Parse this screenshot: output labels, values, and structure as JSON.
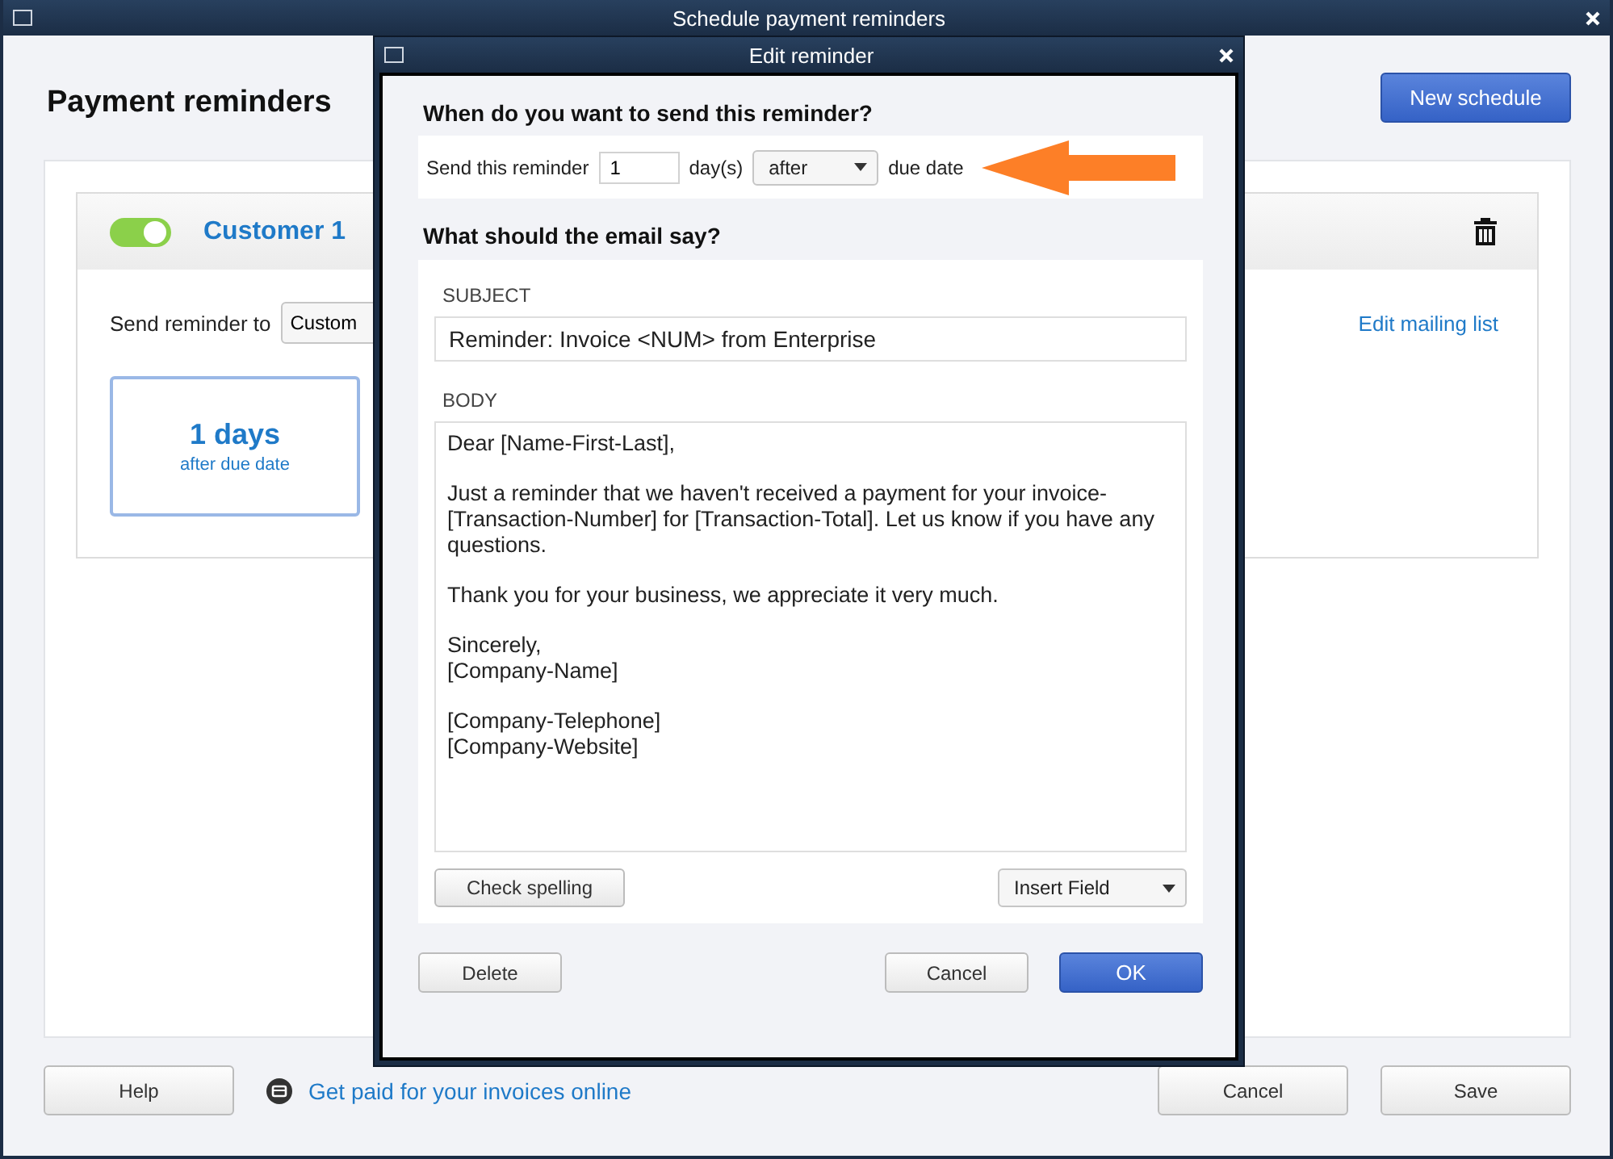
{
  "window": {
    "title": "Schedule payment reminders"
  },
  "page_title": "Payment reminders",
  "new_schedule_button": "New schedule",
  "schedule": {
    "enabled": true,
    "name": "Customer 1",
    "send_to_label": "Send reminder to",
    "send_to_value": "Custom",
    "edit_link": "Edit mailing list",
    "tiles": [
      {
        "days": "1 days",
        "when": "after due date"
      }
    ]
  },
  "footer": {
    "help": "Help",
    "link": "Get paid for your invoices online",
    "cancel": "Cancel",
    "save": "Save"
  },
  "dialog": {
    "title": "Edit reminder",
    "timing_heading": "When do you want to send this reminder?",
    "send_label": "Send this reminder",
    "days_value": "1",
    "days_unit": "day(s)",
    "relation": "after",
    "due_label": "due date",
    "email_heading": "What should the email say?",
    "subject_label": "SUBJECT",
    "subject_value": "Reminder: Invoice <NUM> from Enterprise",
    "body_label": "BODY",
    "body_paragraphs": [
      "Dear [Name-First-Last],",
      "Just a reminder that we haven't received a payment for your invoice-\n[Transaction-Number] for [Transaction-Total]. Let us know if you have any\nquestions.",
      "Thank you for your business, we appreciate it very much.",
      "Sincerely,\n[Company-Name]",
      "[Company-Telephone]\n[Company-Website]"
    ],
    "check_spelling": "Check spelling",
    "insert_field": "Insert Field",
    "delete": "Delete",
    "cancel": "Cancel",
    "ok": "OK"
  }
}
